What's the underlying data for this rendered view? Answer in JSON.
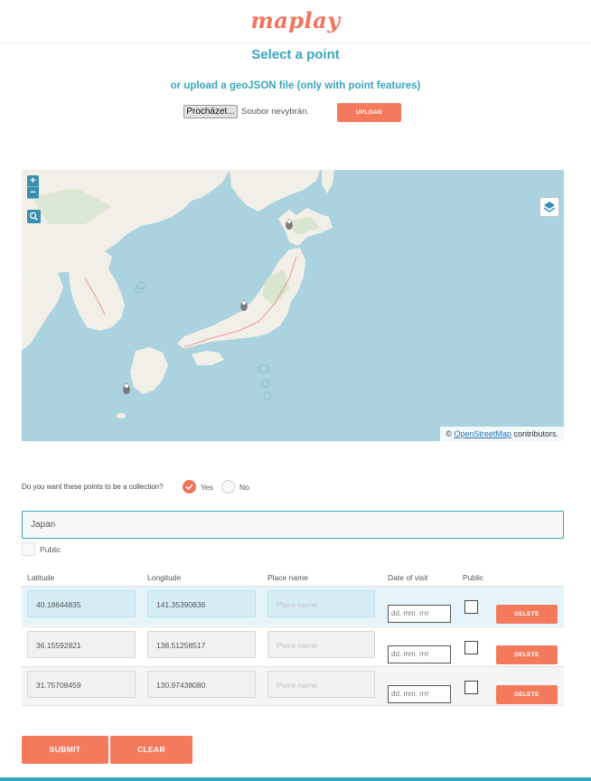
{
  "app": {
    "logo": "maplay"
  },
  "header": {
    "title": "Select a point",
    "subtitle": "or upload a geoJSON file (only with point features)"
  },
  "upload": {
    "browse_label": "Procházet...",
    "no_file_text": "Soubor nevybrán.",
    "upload_label": "UPLOAD"
  },
  "map": {
    "zoom_in": "+",
    "zoom_out": "−",
    "attribution_prefix": "©",
    "attribution_link": "OpenStreetMap",
    "attribution_suffix": "contributors.",
    "markers": [
      {
        "name": "marker-hokkaido"
      },
      {
        "name": "marker-honshu"
      },
      {
        "name": "marker-kyushu"
      }
    ],
    "colors": {
      "sea": "#aad3df",
      "land": "#f2efe9",
      "accent": "#3a8fb0"
    }
  },
  "collection": {
    "question": "Do you want these points to be a collection?",
    "yes_label": "Yes",
    "no_label": "No",
    "selected": "Yes",
    "name_value": "Japan",
    "public_label": "Public"
  },
  "table": {
    "headers": [
      "Latitude",
      "Longitude",
      "Place name",
      "Date of visit",
      "Public"
    ],
    "rows": [
      {
        "latitude": "40.18844835",
        "longitude": "141.35390836",
        "place_placeholder": "Place name",
        "date_placeholder": "dd. mm. rrrr",
        "delete_label": "DELETE"
      },
      {
        "latitude": "36.15592821",
        "longitude": "138.51258517",
        "place_placeholder": "Place name",
        "date_placeholder": "dd. mm. rrrr",
        "delete_label": "DELETE"
      },
      {
        "latitude": "31.75708459",
        "longitude": "130.97438080",
        "place_placeholder": "Place name",
        "date_placeholder": "dd. mm. rrrr",
        "delete_label": "DELETE"
      }
    ]
  },
  "actions": {
    "submit_label": "SUBMIT",
    "clear_label": "CLEAR"
  },
  "colors": {
    "accent": "#f47a5e",
    "heading": "#3aa6bf",
    "row_highlight": "#e4f4f9"
  }
}
